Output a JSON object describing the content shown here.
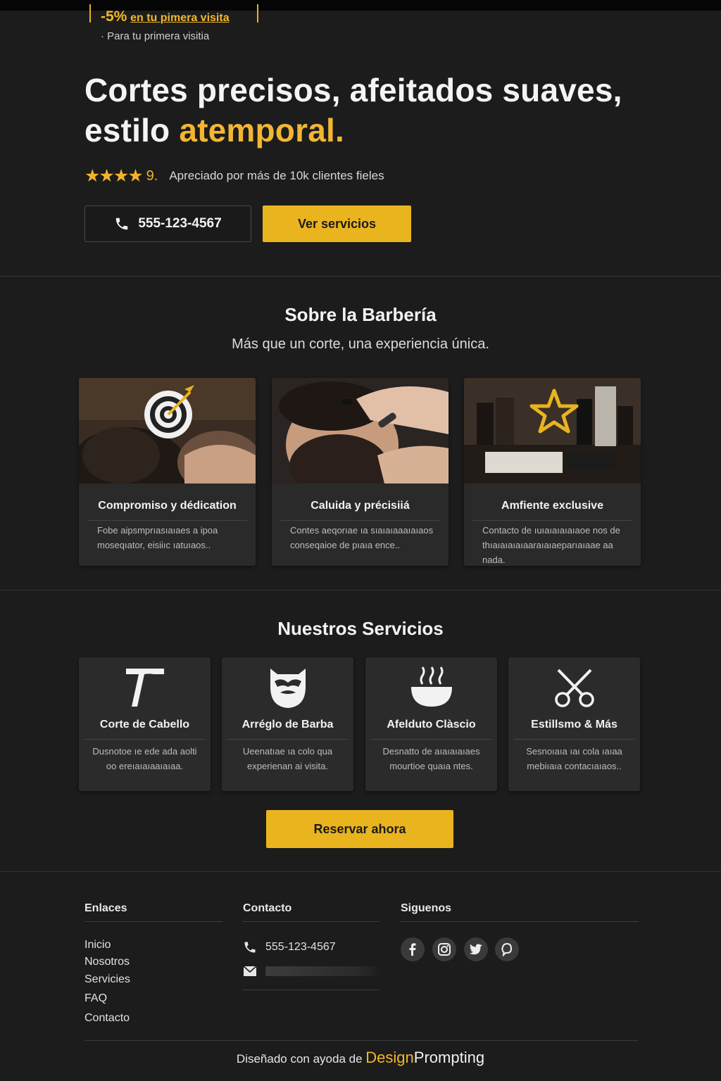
{
  "promo": {
    "discount": "-5%",
    "headline_rest": "en tu pimera visita",
    "subtext": "Para tu primera visitia"
  },
  "hero": {
    "title_main": "Cortes precisos, afeitados suaves, estilo ",
    "title_accent": "atemporal",
    "title_end": ".",
    "stars": "★★★★",
    "rating_value": "9.",
    "rating_text": "Apreciado por más de 10k clientes fieles",
    "phone_button": "555-123-4567",
    "services_button": "Ver servicios"
  },
  "about": {
    "title": "Sobre la Barbería",
    "subtitle": "Más que un corte, una experiencia única.",
    "cards": [
      {
        "icon": "target-icon",
        "title": "Compromiso y dédication",
        "text": "Fobe aipsmprıasıaıaes a ipoa moseqıator, eisiiıc ıatuıaos.."
      },
      {
        "icon": "beard-trim-photo",
        "title": "Caluida y précisiiá",
        "text": "Contes aeqorıae ıa sıaıaıaaaıaıaos conseqaioe de pıaıa ence.."
      },
      {
        "icon": "star-icon",
        "title": "Amfiente exclusive",
        "text": "Contacto de ıuıaıaıaıaıaoe nos de thıaıaıaıaıaaraıaıaeparıaıaae aa nada."
      }
    ]
  },
  "services": {
    "title": "Nuestros Servicios",
    "cards": [
      {
        "icon": "razor-icon",
        "title": "Corte de Cabello",
        "text": "Dusnotoe ıe ede ada aolti oo ereıaıaıaaıaıaa."
      },
      {
        "icon": "beard-icon",
        "title": "Arréglo de Barba",
        "text": "Ueenatıae ıa colo qua experienan ai visita."
      },
      {
        "icon": "hot-towel-icon",
        "title": "Afelduto Clàscio",
        "text": "Desnatto de aıaıaıaıaes mourtioe quaıa ntes."
      },
      {
        "icon": "scissors-icon",
        "title": "Estillsmo & Más",
        "text": "Sesnoıaıa ıaı cola ıaıaa mebiıaıa contacıaıaos.."
      }
    ],
    "reserve_button": "Reservar ahora"
  },
  "footer": {
    "links_heading": "Enlaces",
    "links": [
      "Inicio",
      "Nosotros",
      "Servicies",
      "FAQ",
      "Contacto"
    ],
    "contact_heading": "Contacto",
    "phone": "555-123-4567",
    "follow_heading": "Siguenos",
    "social_icons": [
      "facebook-icon",
      "instagram-icon",
      "twitter-icon",
      "whatsapp-icon"
    ],
    "credits_prefix": "Diseñado con ayoda de",
    "credits_brand_1": "Design",
    "credits_brand_2": "Prompting"
  },
  "colors": {
    "background": "#1c1c1c",
    "accent": "#eab41f",
    "card": "#2a2a2a"
  }
}
